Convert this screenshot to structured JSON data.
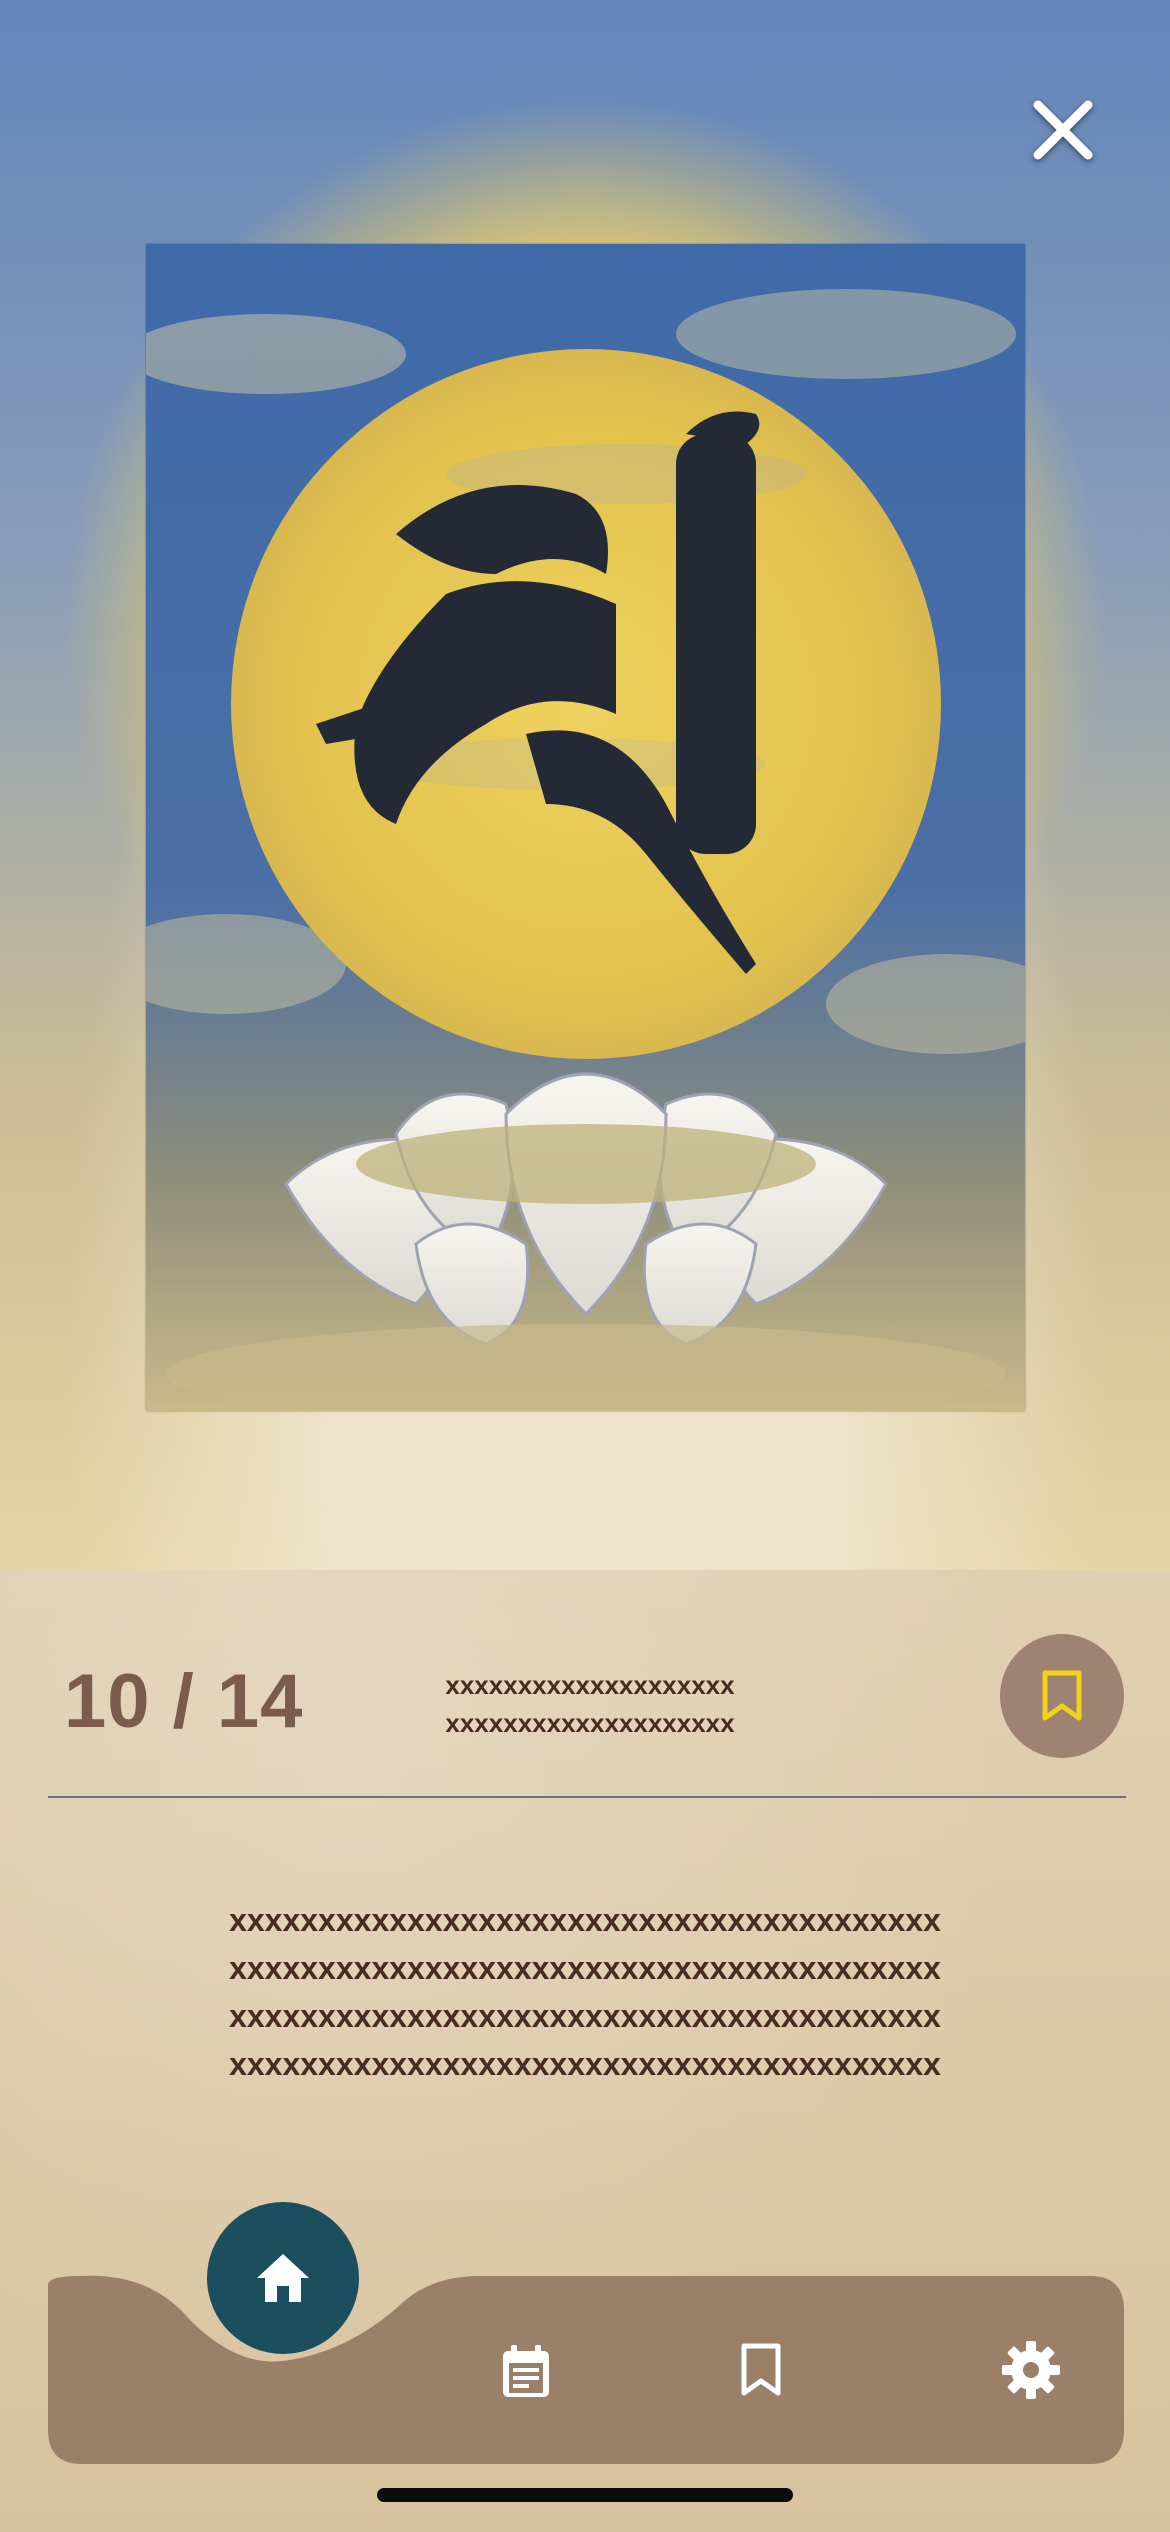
{
  "viewer": {
    "close_icon": "close-icon",
    "image_alt": "Sanskrit seed syllable on full moon above lotus"
  },
  "info": {
    "counter": "10 / 14",
    "subtitle_line1": "xxxxxxxxxxxxxxxxxxxx",
    "subtitle_line2": "xxxxxxxxxxxxxxxxxxxx",
    "bookmark_icon": "bookmark-icon",
    "accent_color": "#f2d21b"
  },
  "content": {
    "lines": [
      "xxxxxxxxxxxxxxxxxxxxxxxxxxxxxxxxxxxxxxxx",
      "xxxxxxxxxxxxxxxxxxxxxxxxxxxxxxxxxxxxxxxx",
      "xxxxxxxxxxxxxxxxxxxxxxxxxxxxxxxxxxxxxxxx",
      "xxxxxxxxxxxxxxxxxxxxxxxxxxxxxxxxxxxxxxxx"
    ]
  },
  "tabbar": {
    "items": [
      {
        "icon": "home-icon",
        "active": true
      },
      {
        "icon": "calendar-icon",
        "active": false
      },
      {
        "icon": "bookmark-icon",
        "active": false
      },
      {
        "icon": "gear-icon",
        "active": false
      }
    ],
    "bar_color": "#9a7f69",
    "active_color": "#1c4f5e"
  }
}
